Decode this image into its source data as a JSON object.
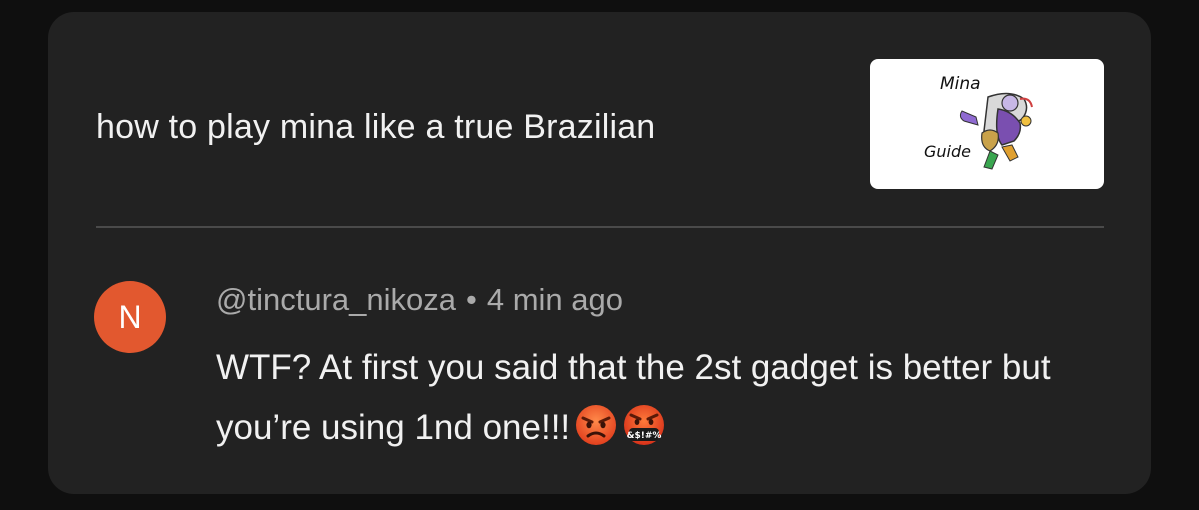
{
  "video": {
    "title": "how to play mina like a true Brazilian",
    "thumbnail": {
      "text_top": "Mina",
      "text_bottom": "Guide",
      "background": "#ffffff"
    }
  },
  "comment": {
    "avatar_letter": "N",
    "avatar_color": "#e2582f",
    "author": "@tinctura_nikoza",
    "separator": "•",
    "time": "4 min ago",
    "text": "WTF? At first you said that the 2st gadget is better but you’re using 1nd one!!!",
    "emojis": [
      "angry-face-icon",
      "face-with-symbols-on-mouth-icon"
    ],
    "emoji_symbols_text": "&$!#%"
  },
  "colors": {
    "card_background": "#222222",
    "page_background": "#0f0f0f",
    "primary_text": "#f1f1f1",
    "secondary_text": "#aaaaaa"
  }
}
